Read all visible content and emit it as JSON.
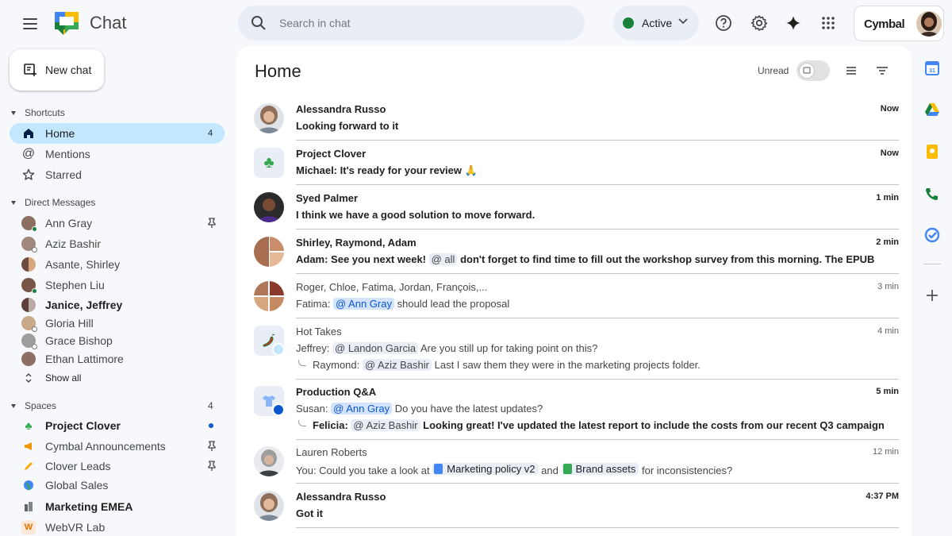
{
  "app": {
    "title": "Chat"
  },
  "search": {
    "placeholder": "Search in chat"
  },
  "status": {
    "label": "Active",
    "color": "#188038"
  },
  "account": {
    "brand": "Cymbal"
  },
  "sidebar": {
    "new_chat": "New chat",
    "shortcuts": {
      "header": "Shortcuts",
      "items": [
        {
          "label": "Home",
          "icon": "home-icon",
          "badge": "4",
          "active": true
        },
        {
          "label": "Mentions",
          "icon": "at-icon"
        },
        {
          "label": "Starred",
          "icon": "star-icon"
        }
      ]
    },
    "direct_messages": {
      "header": "Direct Messages",
      "items": [
        {
          "label": "Ann Gray",
          "pinned": true
        },
        {
          "label": "Aziz Bashir"
        },
        {
          "label": "Asante, Shirley"
        },
        {
          "label": "Stephen Liu"
        },
        {
          "label": "Janice, Jeffrey",
          "bold": true
        },
        {
          "label": "Gloria Hill"
        },
        {
          "label": "Grace Bishop"
        },
        {
          "label": "Ethan Lattimore"
        }
      ],
      "show_all": "Show all"
    },
    "spaces": {
      "header": "Spaces",
      "count": "4",
      "items": [
        {
          "label": "Project Clover",
          "bold": true,
          "unread": true,
          "icon": "clover-icon"
        },
        {
          "label": "Cymbal Announcements",
          "pinned": true,
          "icon": "megaphone-icon"
        },
        {
          "label": "Clover Leads",
          "pinned": true,
          "icon": "pencil-icon"
        },
        {
          "label": "Global Sales",
          "icon": "globe-icon"
        },
        {
          "label": "Marketing EMEA",
          "bold": true,
          "icon": "building-icon"
        },
        {
          "label": "WebVR Lab",
          "icon": "letter-w-icon",
          "letter": "W"
        }
      ]
    }
  },
  "main": {
    "title": "Home",
    "unread_label": "Unread",
    "conversations": [
      {
        "name": "Alessandra Russo",
        "time": "Now",
        "unread": true,
        "lines": [
          {
            "text": "Looking forward to it"
          }
        ]
      },
      {
        "name": "Project Clover",
        "time": "Now",
        "unread": true,
        "lines": [
          {
            "text": "Michael: It's ready for your review 🙏"
          }
        ]
      },
      {
        "name": "Syed Palmer",
        "time": "1 min",
        "unread": true,
        "lines": [
          {
            "text": "I think we have a good solution to move forward."
          }
        ]
      },
      {
        "name": "Shirley, Raymond, Adam",
        "time": "2 min",
        "unread": true,
        "lines": [
          {
            "prefix": "Adam: See you next week!",
            "mention": "@ all",
            "suffix": "don't forget to find time to fill out the workshop survey from this morning. The EPUB"
          }
        ]
      },
      {
        "name": "Roger, Chloe, Fatima, Jordan, François,...",
        "time": "3 min",
        "unread": false,
        "lines": [
          {
            "prefix": "Fatima:",
            "mention": "@ Ann Gray",
            "suffix": "should lead the proposal"
          }
        ]
      },
      {
        "name": "Hot Takes",
        "time": "4 min",
        "unread": false,
        "lines": [
          {
            "prefix": "Jeffrey:",
            "mention": "@ Landon Garcia",
            "suffix": "Are you still up for taking point on this?"
          },
          {
            "prefix": "Raymond:",
            "mention": "@ Aziz Bashir",
            "suffix": "Last I saw them they were in the marketing projects folder."
          }
        ]
      },
      {
        "name": "Production Q&A",
        "time": "5 min",
        "unread": true,
        "lines": [
          {
            "prefix": "Susan:",
            "mention": "@ Ann Gray",
            "suffix": "Do you have the latest updates?"
          },
          {
            "prefix": "Felicia:",
            "mention": "@ Aziz Bashir",
            "suffix": "Looking great! I've updated the latest report to include the costs from our recent Q3 campaign"
          }
        ]
      },
      {
        "name": "Lauren Roberts",
        "time": "12 min",
        "unread": false,
        "lines": [
          {
            "prefix": "You: Could you take a look at",
            "chip1": "Marketing policy v2",
            "mid": "and",
            "chip2": "Brand assets",
            "suffix": "for inconsistencies?"
          }
        ]
      },
      {
        "name": "Alessandra Russo",
        "time": "4:37 PM",
        "unread": true,
        "lines": [
          {
            "text": "Got it"
          }
        ]
      }
    ]
  },
  "colors": {
    "accent": "#0b57d0",
    "active_nav": "#c2e7ff",
    "mention_bg": "#d3e3fd"
  }
}
